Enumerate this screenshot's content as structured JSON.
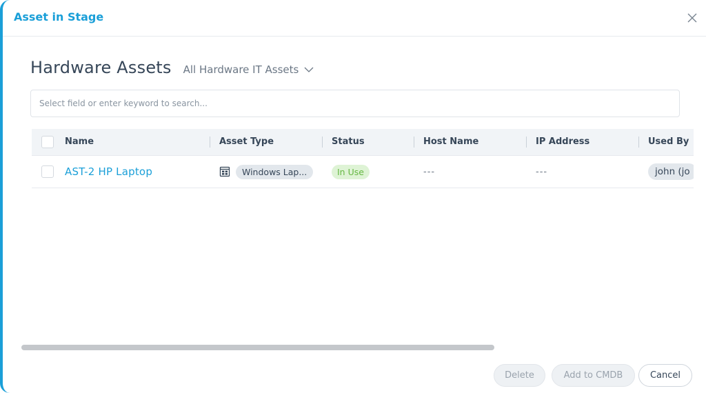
{
  "modal": {
    "title": "Asset in Stage",
    "close_icon": "close-icon"
  },
  "page": {
    "title": "Hardware Assets",
    "view_selector": "All Hardware IT Assets"
  },
  "search": {
    "placeholder": "Select field or enter keyword to search..."
  },
  "table": {
    "columns": [
      "Name",
      "Asset Type",
      "Status",
      "Host Name",
      "IP Address",
      "Used By"
    ],
    "rows": [
      {
        "name": "AST-2 HP Laptop",
        "asset_type_icon": "windows-laptop-icon",
        "asset_type": "Windows Lap...",
        "status": "In Use",
        "host_name": "---",
        "ip_address": "---",
        "used_by": "john (jo"
      }
    ]
  },
  "footer": {
    "delete_label": "Delete",
    "add_cmdb_label": "Add to CMDB",
    "cancel_label": "Cancel"
  },
  "colors": {
    "accent": "#1a9fd8",
    "status_in_use_bg": "#def3d5",
    "status_in_use_text": "#66b843"
  }
}
